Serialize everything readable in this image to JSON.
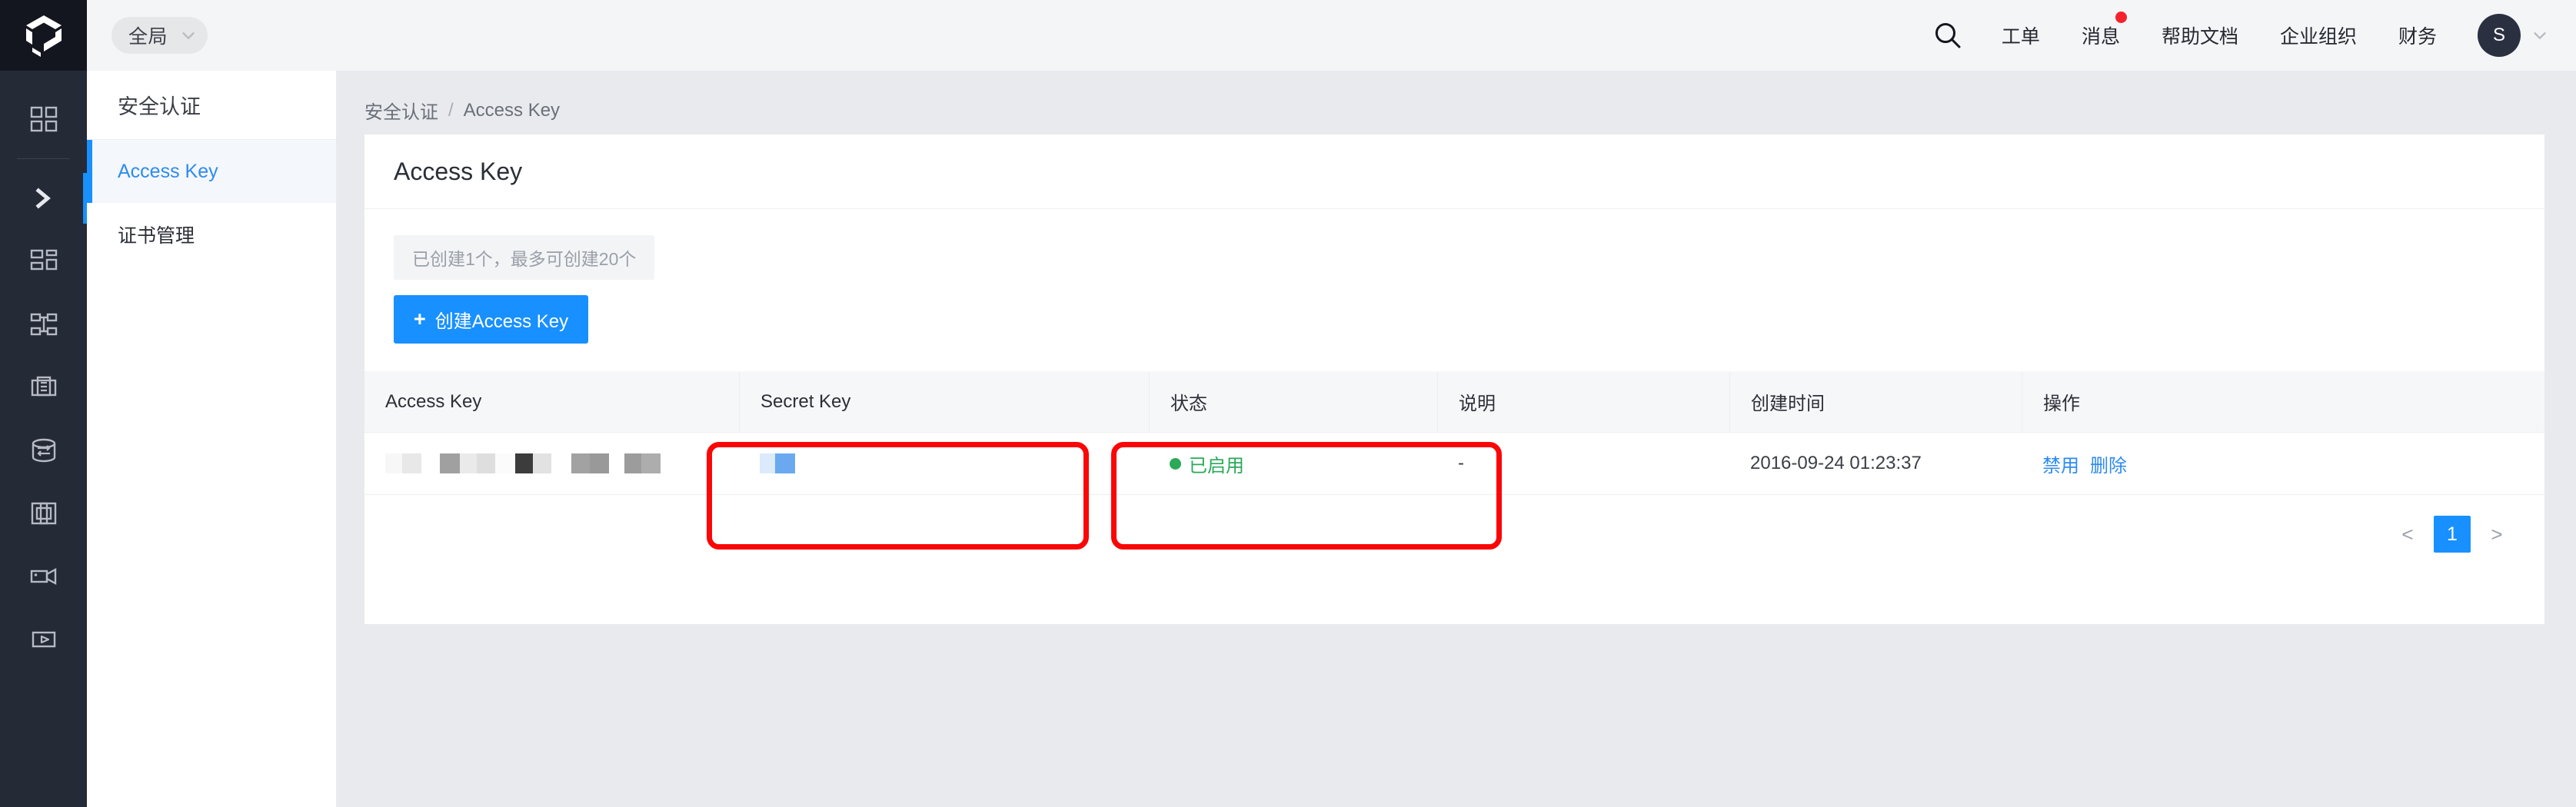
{
  "topbar": {
    "logo_icon": "cube-logo-icon",
    "scope": {
      "label": "全局",
      "chevron_icon": "chevron-down-icon"
    },
    "search_icon": "search-icon",
    "links": [
      {
        "label": "工单",
        "badge": false
      },
      {
        "label": "消息",
        "badge": true
      },
      {
        "label": "帮助文档",
        "badge": false
      },
      {
        "label": "企业组织",
        "badge": false
      },
      {
        "label": "财务",
        "badge": false
      }
    ],
    "avatar": {
      "initial": "S",
      "chevron_icon": "chevron-down-icon"
    }
  },
  "rail": {
    "items": [
      {
        "icon": "grid-dashboard-icon",
        "active": false
      },
      {
        "icon": "chevron-right-expand-icon",
        "active": true
      },
      {
        "icon": "layout-panels-icon",
        "active": false
      },
      {
        "icon": "network-nodes-icon",
        "active": false
      },
      {
        "icon": "server-rack-icon",
        "active": false
      },
      {
        "icon": "database-transfer-icon",
        "active": false
      },
      {
        "icon": "container-frame-icon",
        "active": false
      },
      {
        "icon": "video-camera-icon",
        "active": false
      },
      {
        "icon": "media-play-icon",
        "active": false
      }
    ]
  },
  "subnav": {
    "title": "安全认证",
    "items": [
      {
        "label": "Access Key",
        "active": true
      },
      {
        "label": "证书管理",
        "active": false
      }
    ]
  },
  "breadcrumb": {
    "root": "安全认证",
    "separator": "/",
    "current": "Access Key"
  },
  "card": {
    "title": "Access Key",
    "quota_text": "已创建1个，最多可创建20个",
    "create_button": {
      "label": "创建Access Key",
      "icon": "plus-icon"
    }
  },
  "table": {
    "columns": [
      "Access Key",
      "Secret Key",
      "状态",
      "说明",
      "创建时间",
      "操作"
    ],
    "rows": [
      {
        "access_key": "",
        "secret_key": "",
        "status": "已启用",
        "description": "-",
        "created_at": "2016-09-24 01:23:37",
        "actions": [
          "禁用",
          "删除"
        ]
      }
    ]
  },
  "pagination": {
    "prev": "<",
    "pages": [
      "1"
    ],
    "next": ">",
    "current": "1"
  },
  "annotations": [
    {
      "target": "Access Key",
      "color": "#fb0606"
    },
    {
      "target": "Secret Key",
      "color": "#fb0606"
    }
  ],
  "colors": {
    "accent": "#1890ff",
    "success": "#2aa958",
    "badge": "#f5222d",
    "rail_bg": "#252a37",
    "page_bg": "#e8eaee",
    "annotation": "#fb0606"
  }
}
